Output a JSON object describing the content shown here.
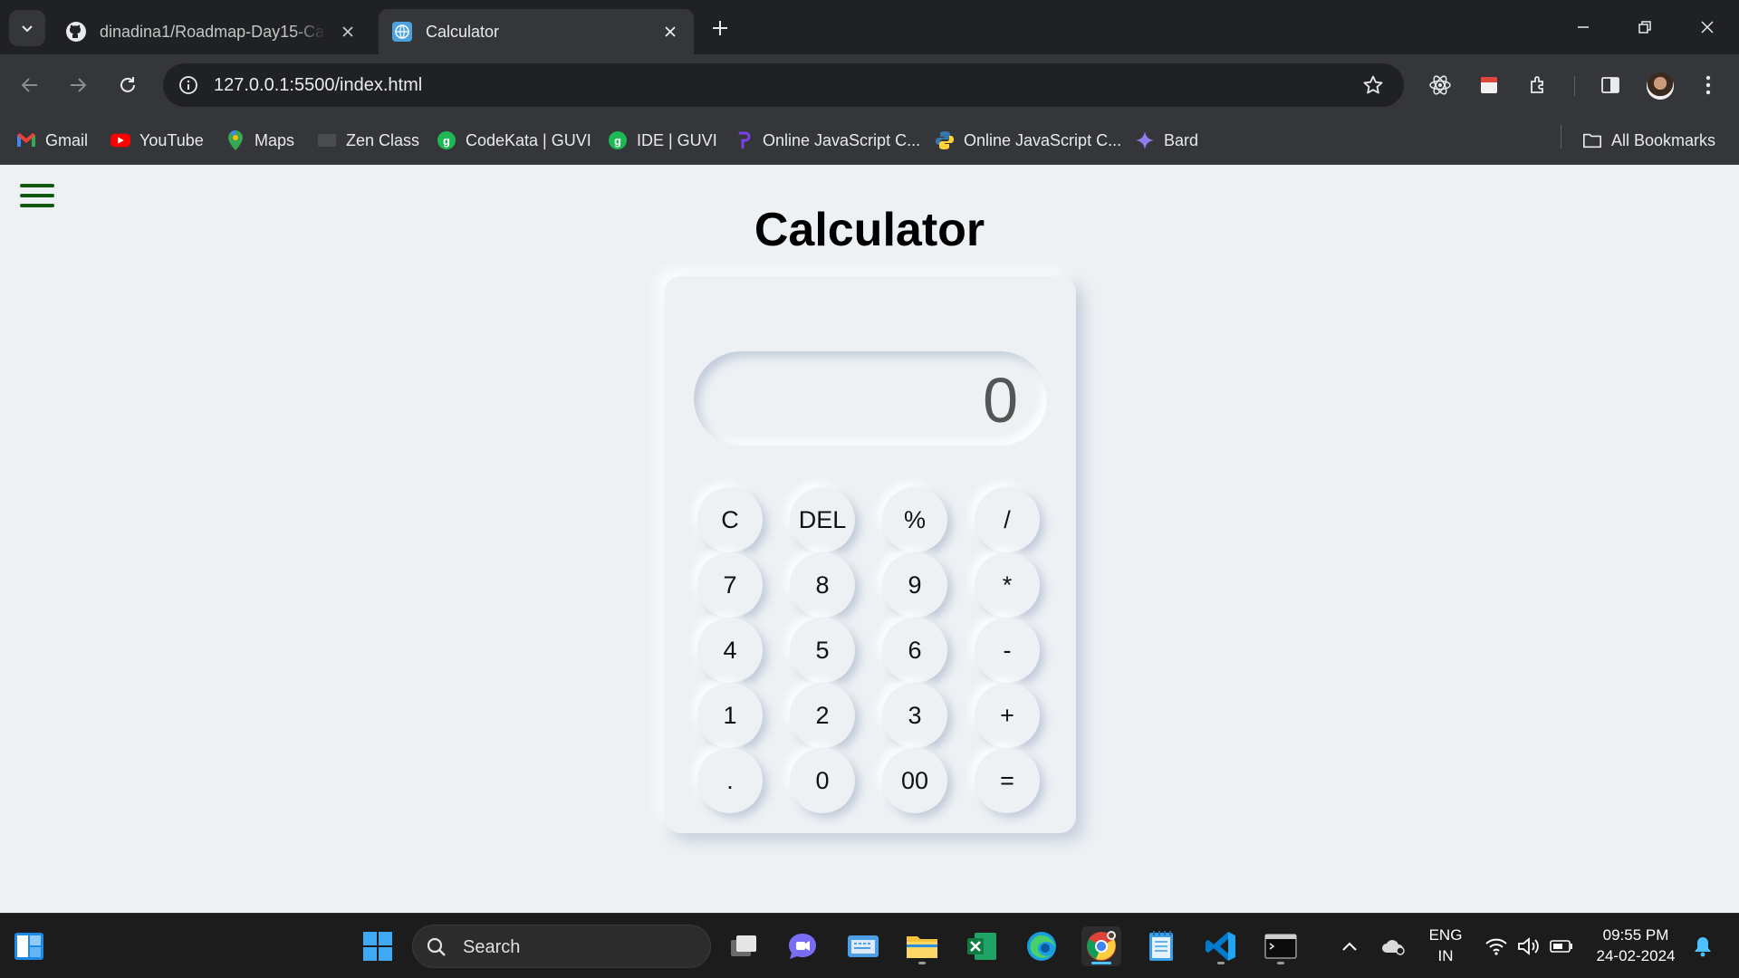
{
  "browser": {
    "tabs": [
      {
        "title": "dinadina1/Roadmap-Day15-Calculator",
        "favicon": "github-icon",
        "active": false
      },
      {
        "title": "Calculator",
        "favicon": "globe-icon",
        "active": true
      }
    ],
    "url": "127.0.0.1:5500/index.html",
    "bookmarks": [
      {
        "label": "Gmail",
        "icon": "gmail-icon"
      },
      {
        "label": "YouTube",
        "icon": "youtube-icon"
      },
      {
        "label": "Maps",
        "icon": "maps-icon"
      },
      {
        "label": "Zen Class",
        "icon": "zen-class-icon"
      },
      {
        "label": "CodeKata | GUVI",
        "icon": "guvi-icon"
      },
      {
        "label": "IDE | GUVI",
        "icon": "guvi-icon"
      },
      {
        "label": "Online JavaScript C...",
        "icon": "programiz-icon"
      },
      {
        "label": "Online JavaScript C...",
        "icon": "python-icon"
      },
      {
        "label": "Bard",
        "icon": "bard-icon"
      }
    ],
    "all_bookmarks_label": "All Bookmarks"
  },
  "page": {
    "title": "Calculator",
    "display_value": "0",
    "keys": [
      [
        "C",
        "DEL",
        "%",
        "/"
      ],
      [
        "7",
        "8",
        "9",
        "*"
      ],
      [
        "4",
        "5",
        "6",
        "-"
      ],
      [
        "1",
        "2",
        "3",
        "+"
      ],
      [
        ".",
        "0",
        "00",
        "="
      ]
    ]
  },
  "taskbar": {
    "search_placeholder": "Search",
    "language_line1": "ENG",
    "language_line2": "IN",
    "time": "09:55 PM",
    "date": "24-02-2024"
  },
  "colors": {
    "page_bg": "#edf1f4",
    "menu_icon": "#0f5a0f",
    "browser_frame": "#202124",
    "toolbar": "#35363a"
  }
}
